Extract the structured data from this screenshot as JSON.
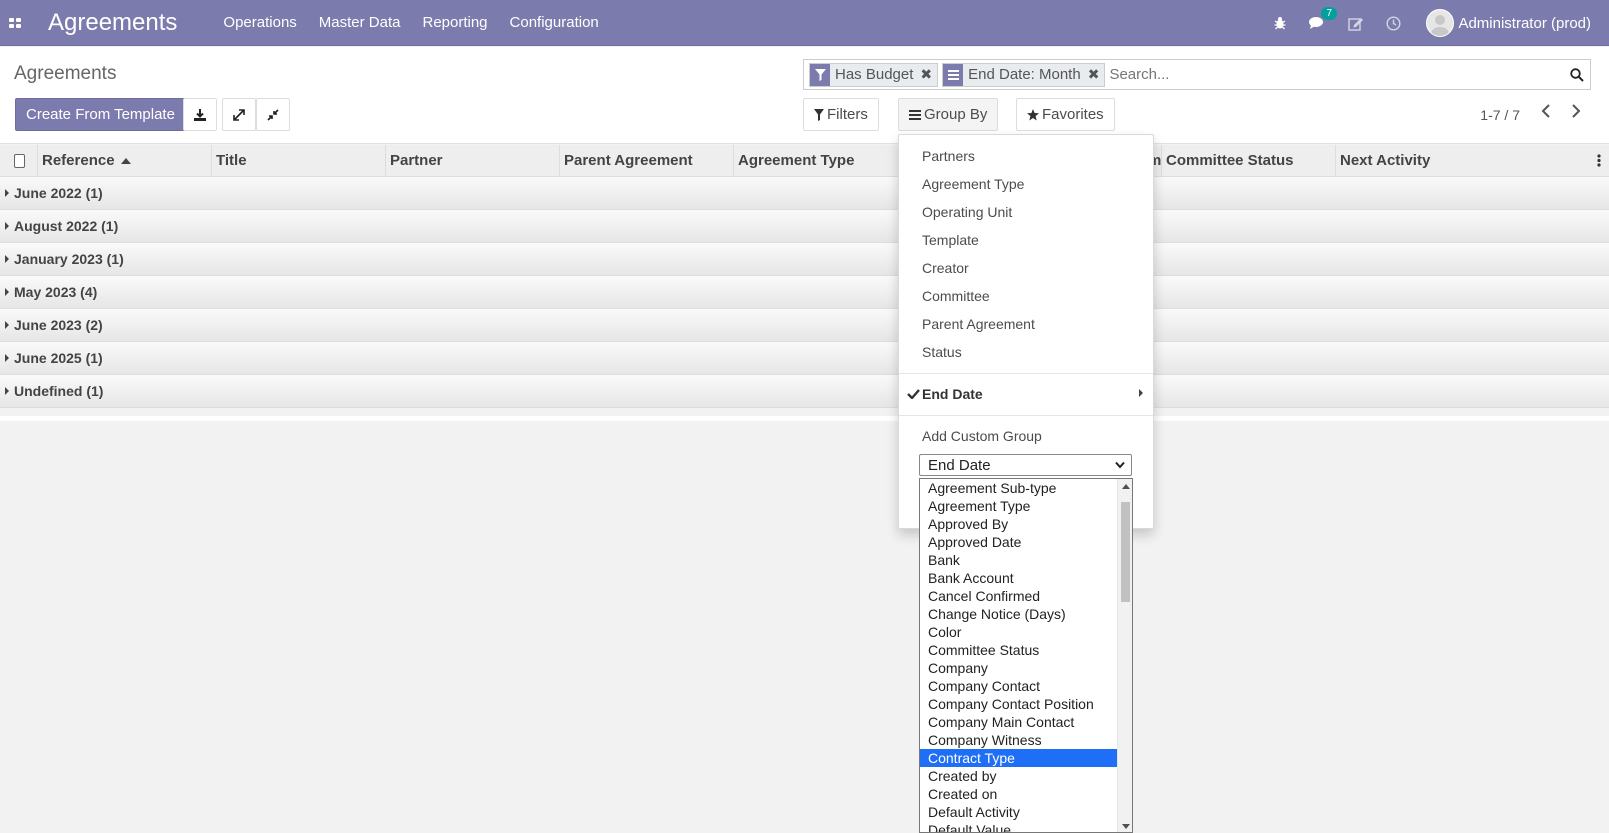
{
  "navbar": {
    "title": "Agreements",
    "menu": [
      "Operations",
      "Master Data",
      "Reporting",
      "Configuration"
    ],
    "messages_count": "7",
    "user_name": "Administrator (prod)",
    "icons": [
      "apps-grid-icon",
      "bug-icon",
      "chat-icon",
      "edit-icon",
      "clock-icon"
    ],
    "color": "#7c7bad"
  },
  "control": {
    "breadcrumb": "Agreements",
    "create_button": "Create From Template",
    "facets": [
      {
        "icon": "filter-icon",
        "label": "Has Budget"
      },
      {
        "icon": "list-icon",
        "label": "End Date: Month"
      }
    ],
    "search_placeholder": "Search...",
    "filters_label": "Filters",
    "group_by_label": "Group By",
    "favorites_label": "Favorites",
    "pager": "1-7 / 7"
  },
  "table": {
    "columns": [
      "Reference",
      "Title",
      "Partner",
      "Parent Agreement",
      "Agreement Type",
      "",
      "Committee",
      "Committee Status",
      "Next Activity"
    ],
    "visible_columns": [
      "Reference",
      "Title",
      "Partner",
      "Parent Agreement",
      "Agreement Type",
      "mmittee",
      "Committee Status",
      "Next Activity"
    ],
    "groups": [
      "June 2022 (1)",
      "August 2022 (1)",
      "January 2023 (1)",
      "May 2023 (4)",
      "June 2023 (2)",
      "June 2025 (1)",
      "Undefined (1)"
    ]
  },
  "group_by_menu": {
    "options": [
      "Partners",
      "Agreement Type",
      "Operating Unit",
      "Template",
      "Creator",
      "Committee",
      "Parent Agreement",
      "Status"
    ],
    "active_option": "End Date",
    "add_custom_label": "Add Custom Group",
    "custom_select_value": "End Date",
    "listbox_options": [
      "Agreement Sub-type",
      "Agreement Type",
      "Approved By",
      "Approved Date",
      "Bank",
      "Bank Account",
      "Cancel Confirmed",
      "Change Notice (Days)",
      "Color",
      "Committee Status",
      "Company",
      "Company Contact",
      "Company Contact Position",
      "Company Main Contact",
      "Company Witness",
      "Contract Type",
      "Created by",
      "Created on",
      "Default Activity",
      "Default Value"
    ],
    "listbox_selected": "Contract Type",
    "selected_color": "#1e6ff5"
  }
}
